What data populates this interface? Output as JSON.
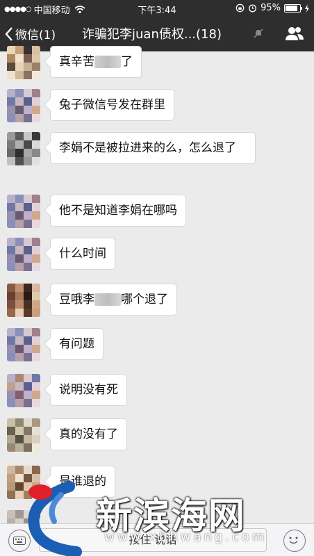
{
  "status_bar": {
    "signal_dots": "●●●●○",
    "carrier": "中国移动",
    "time": "下午3:44",
    "battery_percent": "95%",
    "battery_level": 0.95
  },
  "nav": {
    "back_label": "微信(1)",
    "title": "诈骗犯李juan债权...(18)"
  },
  "messages": [
    {
      "text_before": "真辛苦",
      "text_after": "了"
    },
    {
      "text": "兔子微信号发在群里"
    },
    {
      "text": "李娟不是被拉进来的么，怎么退了"
    },
    {
      "text": "他不是知道李娟在哪吗"
    },
    {
      "text": "什么时间"
    },
    {
      "text_before": "豆哦李",
      "text_after": "哪个退了"
    },
    {
      "text": "有问题"
    },
    {
      "text": "说明没有死"
    },
    {
      "text": "真的没有了"
    },
    {
      "text": "是谁退的"
    }
  ],
  "input_bar": {
    "talk_label": "按住 说话"
  },
  "watermark": {
    "title": "新滨海网",
    "url": "www.xbhwang.com"
  },
  "colors": {
    "bar_bg": "#2e2e2e",
    "chat_bg": "#ebebeb",
    "bubble_bg": "#ffffff",
    "logo_red": "#e0202a",
    "logo_blue": "#1a5fb4"
  }
}
